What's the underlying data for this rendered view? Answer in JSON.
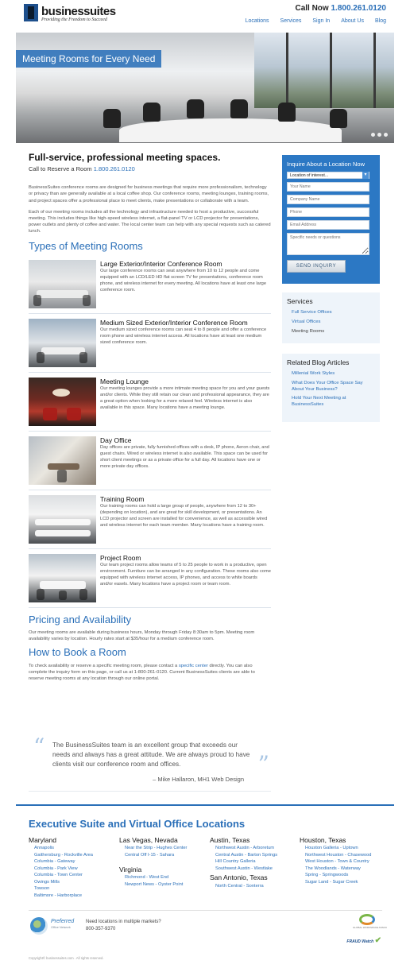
{
  "header": {
    "logo_word": "businessuites",
    "logo_tagline": "Providing the Freedom to Succeed",
    "call_label": "Call Now",
    "call_number": "1.800.261.0120",
    "nav": [
      "Locations",
      "Services",
      "Sign In",
      "About Us",
      "Blog"
    ]
  },
  "hero": {
    "caption": "Meeting Rooms for Every Need",
    "slide_count": 3
  },
  "main": {
    "title": "Full-service, professional meeting spaces.",
    "call_prefix": "Call to Reserve a Room",
    "call_number": "1.800.261.0120",
    "intro": [
      "BusinessSuites conference rooms are designed for business meetings that require more professionalism, technology or privacy than are generally available at a local coffee shop. Our conference rooms, meeting lounges, training rooms, and project spaces offer a professional place to meet clients, make presentations or collaborate with a team.",
      "Each of our meeting rooms includes all the technology and infrastructure needed to host a productive, successful meeting. This includes things like high-speed wireless internet, a flat-panel TV or LCD projector for presentations, power outlets and plenty of coffee and water. The local center team can help with any special requests such as catered lunch."
    ],
    "types_heading": "Types of Meeting Rooms",
    "rooms": [
      {
        "title": "Large Exterior/Interior Conference Room",
        "desc": "Our large conference rooms can seat anywhere from 10 to 12 people and come equipped with an LCD/LED HD flat screen TV for presentations, conference room phone, and wireless internet for every meeting. All locations have at least one large conference room."
      },
      {
        "title": "Medium Sized Exterior/Interior Conference Room",
        "desc": "Our medium sized conference rooms can seat 4 to 8 people and offer a conference room phone and wireless internet access. All locations have at least one medium sized conference room."
      },
      {
        "title": "Meeting Lounge",
        "desc": "Our meeting lounges provide a more intimate meeting space for you and your guests and/or clients. While they still retain our clean and professional appearance, they are a great option when looking for a more relaxed feel. Wireless internet is also available in this space. Many locations have a meeting lounge."
      },
      {
        "title": "Day Office",
        "desc": "Day offices are private, fully furnished offices with a desk, IP phone, Aeron chair, and guest chairs. Wired or wireless internet is also available. This space can be used for short client meetings or as a private office for a full day. All locations have one or more private day offices."
      },
      {
        "title": "Training Room",
        "desc": "Our training rooms can hold a large group of people, anywhere from 12 to 30+ (depending on location), and are great for skill development, or presentations. An LCD projector and screen are installed for convenience, as well as accessible wired and wireless internet for each team member. Many locations have a training room."
      },
      {
        "title": "Project Room",
        "desc": "Our team project rooms allow teams of 5 to 25 people to work in a productive, open environment. Furniture can be arranged in any configuration. These rooms also come equipped with wireless internet access, IP phones, and access to white boards and/or easels. Many locations have a project room or team room."
      }
    ],
    "pricing_heading": "Pricing and Availability",
    "pricing_text": "Our meeting rooms are available during business hours, Monday through Friday 8:30am to 5pm. Meeting room availability varies by location. Hourly rates start at $35/hour for a medium conference room.",
    "book_heading": "How to Book a Room",
    "book_text_1": "To check availability or reserve a specific meeting room, please contact a",
    "book_link": "specific center",
    "book_text_2": "directly. You can also complete the inquiry form on this page, or call us at 1-800-261-0120. Current BusinessSuites clients are able to reserve meeting rooms at any location through our online portal."
  },
  "quote": {
    "text": "The BusinessSuites team is an excellent group that exceeds our needs and always has a great attitude. We are always proud to have clients visit our conference room and offices.",
    "attribution": "– Mike Hallaron, MH1 Web Design"
  },
  "inquiry": {
    "title": "Inquire About a Location Now",
    "location_select": "Location of interest...",
    "name_placeholder": "Your Name",
    "company_placeholder": "Company Name",
    "phone_placeholder": "Phone",
    "email_placeholder": "Email Address",
    "notes_placeholder": "Specific needs or questions",
    "send_label": "SEND INQUIRY"
  },
  "services": {
    "heading": "Services",
    "items": [
      {
        "label": "Full Service Offices",
        "link": true
      },
      {
        "label": "Virtual Offices",
        "link": true
      },
      {
        "label": "Meeting Rooms",
        "link": false
      }
    ]
  },
  "blog": {
    "heading": "Related Blog Articles",
    "items": [
      "Millenial Work Styles",
      "What Does Your Office Space Say About Your Business?",
      "Hold Your Next Meeting at BusinessSuites"
    ]
  },
  "locations": {
    "heading": "Executive Suite and Virtual Office Locations",
    "columns": [
      [
        {
          "name": "Maryland",
          "items": [
            "Annapolis",
            "Gaithersburg - Rockville Area",
            "Columbia - Gateway",
            "Columbia - Park View",
            "Columbia - Town Center",
            "Owings Mills",
            "Towson",
            "Baltimore - Harborplace"
          ]
        }
      ],
      [
        {
          "name": "Las Vegas, Nevada",
          "items": [
            "Near the Strip - Hughes Center",
            "Central Off I-15 - Sahara"
          ]
        },
        {
          "name": "Virginia",
          "items": [
            "Richmond - West End",
            "Newport News - Oyster Point"
          ]
        }
      ],
      [
        {
          "name": "Austin, Texas",
          "items": [
            "Northwest Austin - Arboretum",
            "Central Austin - Barton Springs",
            "Hill Country Galleria",
            "Southwest Austin - Westlake"
          ]
        },
        {
          "name": "San Antonio, Texas",
          "items": [
            "North Central - Sonterra"
          ]
        }
      ],
      [
        {
          "name": "Houston, Texas",
          "items": [
            "Houston Galleria - Uptown",
            "Northwest Houston - Chasewood",
            "West Houston - Town & Country",
            "The Woodlands - Waterway",
            "Spring - Springwoods",
            "Sugar Land - Sugar Creek"
          ]
        }
      ]
    ]
  },
  "footer": {
    "pon_word": "Preferred",
    "pon_sub": "Office Network",
    "multi_line1": "Need locations in multiple markets?",
    "multi_line2": "800-357-9370",
    "cbn_text": "GLOBAL WORKSPACE ASSOC",
    "fraud_text": "FRAUD Watch",
    "copyright": "Copyright© businessuites.com . All rights reserved."
  },
  "colors": {
    "brand_blue": "#2a6fb8",
    "form_blue": "#2c78c4",
    "sidebar_bg": "#eef4fa"
  }
}
